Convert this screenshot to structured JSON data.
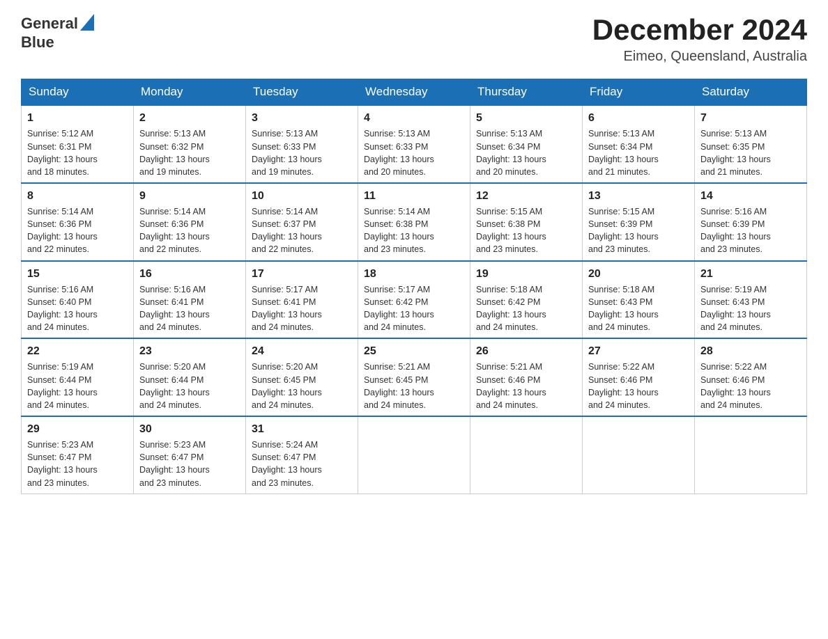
{
  "logo": {
    "text_general": "General",
    "text_blue": "Blue"
  },
  "header": {
    "month_year": "December 2024",
    "location": "Eimeo, Queensland, Australia"
  },
  "days_of_week": [
    "Sunday",
    "Monday",
    "Tuesday",
    "Wednesday",
    "Thursday",
    "Friday",
    "Saturday"
  ],
  "weeks": [
    [
      {
        "day": "1",
        "sunrise": "5:12 AM",
        "sunset": "6:31 PM",
        "daylight": "13 hours and 18 minutes."
      },
      {
        "day": "2",
        "sunrise": "5:13 AM",
        "sunset": "6:32 PM",
        "daylight": "13 hours and 19 minutes."
      },
      {
        "day": "3",
        "sunrise": "5:13 AM",
        "sunset": "6:33 PM",
        "daylight": "13 hours and 19 minutes."
      },
      {
        "day": "4",
        "sunrise": "5:13 AM",
        "sunset": "6:33 PM",
        "daylight": "13 hours and 20 minutes."
      },
      {
        "day": "5",
        "sunrise": "5:13 AM",
        "sunset": "6:34 PM",
        "daylight": "13 hours and 20 minutes."
      },
      {
        "day": "6",
        "sunrise": "5:13 AM",
        "sunset": "6:34 PM",
        "daylight": "13 hours and 21 minutes."
      },
      {
        "day": "7",
        "sunrise": "5:13 AM",
        "sunset": "6:35 PM",
        "daylight": "13 hours and 21 minutes."
      }
    ],
    [
      {
        "day": "8",
        "sunrise": "5:14 AM",
        "sunset": "6:36 PM",
        "daylight": "13 hours and 22 minutes."
      },
      {
        "day": "9",
        "sunrise": "5:14 AM",
        "sunset": "6:36 PM",
        "daylight": "13 hours and 22 minutes."
      },
      {
        "day": "10",
        "sunrise": "5:14 AM",
        "sunset": "6:37 PM",
        "daylight": "13 hours and 22 minutes."
      },
      {
        "day": "11",
        "sunrise": "5:14 AM",
        "sunset": "6:38 PM",
        "daylight": "13 hours and 23 minutes."
      },
      {
        "day": "12",
        "sunrise": "5:15 AM",
        "sunset": "6:38 PM",
        "daylight": "13 hours and 23 minutes."
      },
      {
        "day": "13",
        "sunrise": "5:15 AM",
        "sunset": "6:39 PM",
        "daylight": "13 hours and 23 minutes."
      },
      {
        "day": "14",
        "sunrise": "5:16 AM",
        "sunset": "6:39 PM",
        "daylight": "13 hours and 23 minutes."
      }
    ],
    [
      {
        "day": "15",
        "sunrise": "5:16 AM",
        "sunset": "6:40 PM",
        "daylight": "13 hours and 24 minutes."
      },
      {
        "day": "16",
        "sunrise": "5:16 AM",
        "sunset": "6:41 PM",
        "daylight": "13 hours and 24 minutes."
      },
      {
        "day": "17",
        "sunrise": "5:17 AM",
        "sunset": "6:41 PM",
        "daylight": "13 hours and 24 minutes."
      },
      {
        "day": "18",
        "sunrise": "5:17 AM",
        "sunset": "6:42 PM",
        "daylight": "13 hours and 24 minutes."
      },
      {
        "day": "19",
        "sunrise": "5:18 AM",
        "sunset": "6:42 PM",
        "daylight": "13 hours and 24 minutes."
      },
      {
        "day": "20",
        "sunrise": "5:18 AM",
        "sunset": "6:43 PM",
        "daylight": "13 hours and 24 minutes."
      },
      {
        "day": "21",
        "sunrise": "5:19 AM",
        "sunset": "6:43 PM",
        "daylight": "13 hours and 24 minutes."
      }
    ],
    [
      {
        "day": "22",
        "sunrise": "5:19 AM",
        "sunset": "6:44 PM",
        "daylight": "13 hours and 24 minutes."
      },
      {
        "day": "23",
        "sunrise": "5:20 AM",
        "sunset": "6:44 PM",
        "daylight": "13 hours and 24 minutes."
      },
      {
        "day": "24",
        "sunrise": "5:20 AM",
        "sunset": "6:45 PM",
        "daylight": "13 hours and 24 minutes."
      },
      {
        "day": "25",
        "sunrise": "5:21 AM",
        "sunset": "6:45 PM",
        "daylight": "13 hours and 24 minutes."
      },
      {
        "day": "26",
        "sunrise": "5:21 AM",
        "sunset": "6:46 PM",
        "daylight": "13 hours and 24 minutes."
      },
      {
        "day": "27",
        "sunrise": "5:22 AM",
        "sunset": "6:46 PM",
        "daylight": "13 hours and 24 minutes."
      },
      {
        "day": "28",
        "sunrise": "5:22 AM",
        "sunset": "6:46 PM",
        "daylight": "13 hours and 24 minutes."
      }
    ],
    [
      {
        "day": "29",
        "sunrise": "5:23 AM",
        "sunset": "6:47 PM",
        "daylight": "13 hours and 23 minutes."
      },
      {
        "day": "30",
        "sunrise": "5:23 AM",
        "sunset": "6:47 PM",
        "daylight": "13 hours and 23 minutes."
      },
      {
        "day": "31",
        "sunrise": "5:24 AM",
        "sunset": "6:47 PM",
        "daylight": "13 hours and 23 minutes."
      },
      null,
      null,
      null,
      null
    ]
  ],
  "labels": {
    "sunrise": "Sunrise:",
    "sunset": "Sunset:",
    "daylight": "Daylight:"
  }
}
